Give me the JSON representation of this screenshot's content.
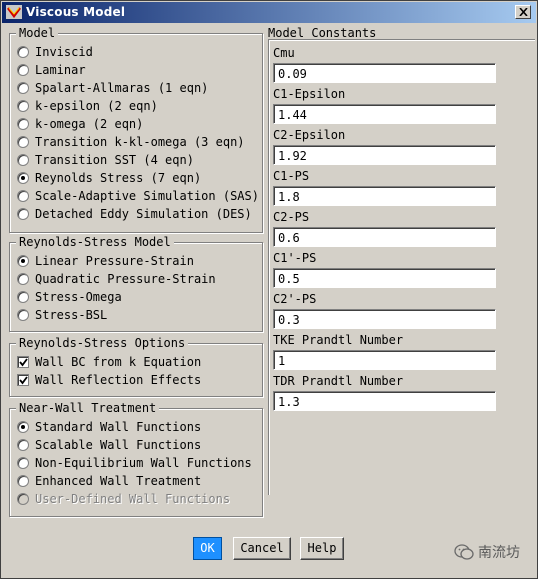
{
  "window": {
    "title": "Viscous Model"
  },
  "model": {
    "legend": "Model",
    "options": [
      {
        "label": "Inviscid",
        "selected": false
      },
      {
        "label": "Laminar",
        "selected": false
      },
      {
        "label": "Spalart-Allmaras (1 eqn)",
        "selected": false
      },
      {
        "label": "k-epsilon (2 eqn)",
        "selected": false
      },
      {
        "label": "k-omega (2 eqn)",
        "selected": false
      },
      {
        "label": "Transition k-kl-omega (3 eqn)",
        "selected": false
      },
      {
        "label": "Transition SST (4 eqn)",
        "selected": false
      },
      {
        "label": "Reynolds Stress (7 eqn)",
        "selected": true
      },
      {
        "label": "Scale-Adaptive Simulation (SAS)",
        "selected": false
      },
      {
        "label": "Detached Eddy Simulation (DES)",
        "selected": false
      }
    ]
  },
  "rsm": {
    "legend": "Reynolds-Stress Model",
    "options": [
      {
        "label": "Linear Pressure-Strain",
        "selected": true
      },
      {
        "label": "Quadratic Pressure-Strain",
        "selected": false
      },
      {
        "label": "Stress-Omega",
        "selected": false
      },
      {
        "label": "Stress-BSL",
        "selected": false
      }
    ]
  },
  "rs_options": {
    "legend": "Reynolds-Stress Options",
    "options": [
      {
        "label": "Wall BC from k Equation",
        "checked": true
      },
      {
        "label": "Wall Reflection Effects",
        "checked": true
      }
    ]
  },
  "near_wall": {
    "legend": "Near-Wall Treatment",
    "options": [
      {
        "label": "Standard Wall Functions",
        "selected": true,
        "enabled": true
      },
      {
        "label": "Scalable Wall Functions",
        "selected": false,
        "enabled": true
      },
      {
        "label": "Non-Equilibrium Wall Functions",
        "selected": false,
        "enabled": true
      },
      {
        "label": "Enhanced Wall Treatment",
        "selected": false,
        "enabled": true
      },
      {
        "label": "User-Defined Wall Functions",
        "selected": false,
        "enabled": false
      }
    ]
  },
  "constants": {
    "title": "Model Constants",
    "items": [
      {
        "label": "Cmu",
        "value": "0.09"
      },
      {
        "label": "C1-Epsilon",
        "value": "1.44"
      },
      {
        "label": "C2-Epsilon",
        "value": "1.92"
      },
      {
        "label": "C1-PS",
        "value": "1.8"
      },
      {
        "label": "C2-PS",
        "value": "0.6"
      },
      {
        "label": "C1'-PS",
        "value": "0.5"
      },
      {
        "label": "C2'-PS",
        "value": "0.3"
      },
      {
        "label": "TKE Prandtl Number",
        "value": "1"
      },
      {
        "label": "TDR Prandtl Number",
        "value": "1.3"
      }
    ]
  },
  "buttons": {
    "ok": "OK",
    "cancel": "Cancel",
    "help": "Help"
  },
  "watermark": {
    "text": "南流坊"
  }
}
